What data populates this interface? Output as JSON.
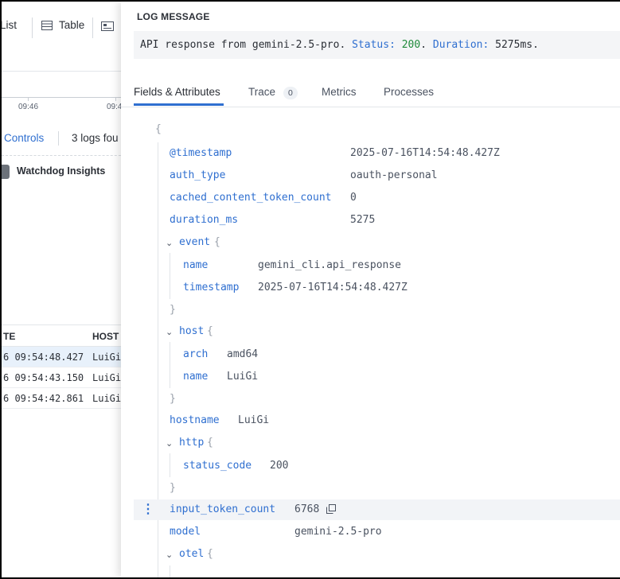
{
  "background": {
    "view_tabs": {
      "list": "List",
      "table": "Table"
    },
    "timeline_ticks": [
      "09:46",
      "09:4"
    ],
    "controls_label": "Controls",
    "logs_found": "3 logs fou",
    "watchdog_label": "Watchdog Insights",
    "table_headers": {
      "date": "TE",
      "host": "HOST"
    },
    "rows": [
      {
        "date": "6 09:54:48.427",
        "host": "LuiGi",
        "selected": true
      },
      {
        "date": "6 09:54:43.150",
        "host": "LuiGi",
        "selected": false
      },
      {
        "date": "6 09:54:42.861",
        "host": "LuiGi",
        "selected": false
      }
    ]
  },
  "panel": {
    "log_message_title": "LOG MESSAGE",
    "log_message": {
      "prefix": "API response from gemini-2.5-pro.",
      "status_key": "Status:",
      "status_value": "200",
      "sep": ".",
      "duration_key": "Duration:",
      "duration_value": "5275ms."
    },
    "tabs": {
      "fields": "Fields & Attributes",
      "trace": "Trace",
      "trace_count": "0",
      "metrics": "Metrics",
      "processes": "Processes"
    },
    "attributes": {
      "open_brace": "{",
      "timestamp_key": "@timestamp",
      "timestamp_value": "2025-07-16T14:54:48.427Z",
      "auth_type_key": "auth_type",
      "auth_type_value": "oauth-personal",
      "cached_key": "cached_content_token_count",
      "cached_value": "0",
      "duration_key": "duration_ms",
      "duration_value": "5275",
      "event_key": "event",
      "event_name_key": "name",
      "event_name_value": "gemini_cli.api_response",
      "event_ts_key": "timestamp",
      "event_ts_value": "2025-07-16T14:54:48.427Z",
      "host_key": "host",
      "host_arch_key": "arch",
      "host_arch_value": "amd64",
      "host_name_key": "name",
      "host_name_value": "LuiGi",
      "hostname_key": "hostname",
      "hostname_value": "LuiGi",
      "http_key": "http",
      "status_code_key": "status_code",
      "status_code_value": "200",
      "input_token_key": "input_token_count",
      "input_token_value": "6768",
      "model_key": "model",
      "model_value": "gemini-2.5-pro",
      "otel_key": "otel",
      "brace_open": "{",
      "brace_close": "}"
    },
    "colors": {
      "key": "#2f6fd0",
      "accent": "#2f6fd0",
      "status_number": "#1f8a3a"
    }
  }
}
